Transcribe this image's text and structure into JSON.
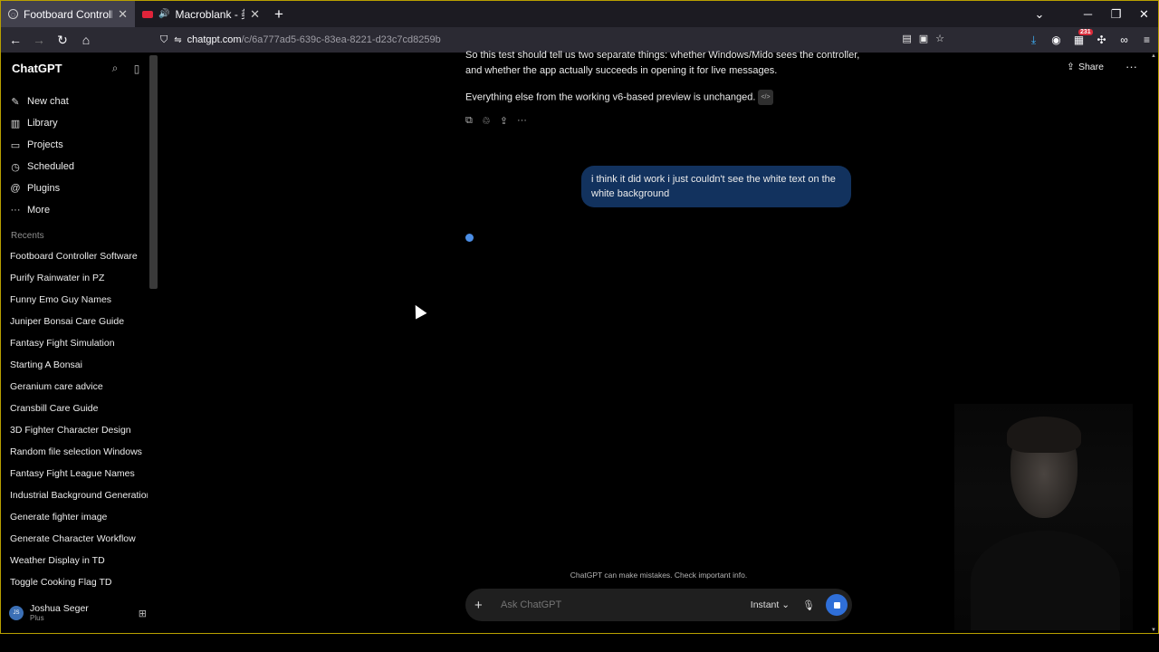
{
  "browser": {
    "tabs": [
      {
        "label": "Footboard Controller Software",
        "active": true
      },
      {
        "label": "Macroblank - 美容師 COLL",
        "active": false
      }
    ],
    "url_host": "chatgpt.com",
    "url_path": "/c/6a777ad5-639c-83ea-8221-d23c7cd8259b",
    "extension_badge": "231"
  },
  "sidebar": {
    "title": "ChatGPT",
    "nav": [
      {
        "label": "New chat",
        "icon": "edit-icon"
      },
      {
        "label": "Library",
        "icon": "library-icon"
      },
      {
        "label": "Projects",
        "icon": "folder-icon"
      },
      {
        "label": "Scheduled",
        "icon": "clock-icon"
      },
      {
        "label": "Plugins",
        "icon": "plugin-icon"
      },
      {
        "label": "More",
        "icon": "dots-icon"
      }
    ],
    "recents_label": "Recents",
    "recents": [
      "Footboard Controller Software",
      "Purify Rainwater in PZ",
      "Funny Emo Guy Names",
      "Juniper Bonsai Care Guide",
      "Fantasy Fight Simulation",
      "Starting A Bonsai",
      "Geranium care advice",
      "Cransbill Care Guide",
      "3D Fighter Character Design",
      "Random file selection Windows",
      "Fantasy Fight League Names",
      "Industrial Background Generation",
      "Generate fighter image",
      "Generate Character Workflow",
      "Weather Display in TD",
      "Toggle Cooking Flag TD"
    ],
    "user": {
      "name": "Joshua Seger",
      "plan": "Plus",
      "initials": "JS"
    }
  },
  "main": {
    "share_label": "Share",
    "assistant_para1": "So this test should tell us two separate things: whether Windows/Mido sees the controller, and whether the app actually succeeds in opening it for live messages.",
    "assistant_para2": "Everything else from the working v6-based preview is unchanged.",
    "code_chip": "</>",
    "user_message": "i think it did work i just couldn't see the white text on the white background",
    "disclaimer": "ChatGPT can make mistakes. Check important info.",
    "composer_placeholder": "Ask ChatGPT",
    "model_label": "Instant"
  },
  "colors": {
    "user_bubble": "#12325e",
    "accent": "#2f6fd8",
    "thinking_dot": "#4b8ee6"
  }
}
